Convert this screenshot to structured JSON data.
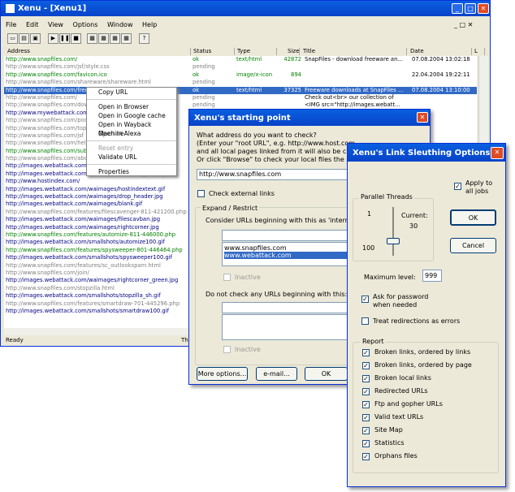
{
  "main_window": {
    "title": "Xenu - [Xenu1]",
    "menu": [
      "File",
      "Edit",
      "View",
      "Options",
      "Window",
      "Help"
    ],
    "status": "Ready",
    "status_right": "Thre"
  },
  "columns": {
    "address": "Address",
    "status": "Status",
    "type": "Type",
    "size": "Size",
    "title": "Title",
    "date": "Date",
    "extra": "L"
  },
  "rows": [
    {
      "a": "http://www.snapfiles.com/",
      "s": "ok",
      "t": "text/html",
      "z": "42872",
      "ti": "SnapFiles - download freeware an...",
      "d": "07.08.2004 13:02:18",
      "c": "ok"
    },
    {
      "a": "http://www.snapfiles.com/jsf/style.css",
      "s": "pending",
      "t": "",
      "z": "",
      "ti": "",
      "d": "",
      "c": "pend"
    },
    {
      "a": "http://www.snapfiles.com/favicon.ico",
      "s": "ok",
      "t": "image/x-icon",
      "z": "894",
      "ti": "",
      "d": "22.04.2004 19:22:11",
      "c": "ok"
    },
    {
      "a": "http://www.snapfiles.com/shareware/shareware.html",
      "s": "pending",
      "t": "",
      "z": "",
      "ti": "",
      "d": "",
      "c": "pend"
    },
    {
      "a": "http://www.snapfiles.com/freeware/freeware.html",
      "s": "ok",
      "t": "text/html",
      "z": "37325",
      "ti": "Freeware downloads at SnapFiles ...",
      "d": "07.08.2004 13:10:00",
      "c": "sel"
    },
    {
      "a": "http://www.snapfiles.com/",
      "s": "pending",
      "t": "",
      "z": "",
      "ti": "Check out<br> our collection of",
      "d": "",
      "c": "pend"
    },
    {
      "a": "http://www.snapfiles.com/downloads",
      "s": "pending",
      "t": "",
      "z": "",
      "ti": "<IMG src=\"http://images.webatt...",
      "d": "",
      "c": "pend"
    },
    {
      "a": "http://www.mywebattack.com/",
      "s": "",
      "t": "",
      "z": "",
      "ti": "",
      "d": "",
      "c": "nav"
    },
    {
      "a": "http://www.snapfiles.com/podcast",
      "s": "",
      "t": "",
      "z": "",
      "ti": "",
      "d": "",
      "c": "pend"
    },
    {
      "a": "http://www.snapfiles.com/topd",
      "s": "",
      "t": "",
      "z": "",
      "ti": "",
      "d": "",
      "c": "pend"
    },
    {
      "a": "http://www.snapfiles.com/jsf",
      "s": "",
      "t": "",
      "z": "",
      "ti": "",
      "d": "",
      "c": "pend"
    },
    {
      "a": "http://www.snapfiles.com/help/",
      "s": "",
      "t": "",
      "z": "",
      "ti": "",
      "d": "",
      "c": "pend"
    },
    {
      "a": "http://www.snapfiles.com/submit",
      "s": "",
      "t": "",
      "z": "",
      "ti": "",
      "d": "",
      "c": "ok"
    },
    {
      "a": "http://www.snapfiles.com/about",
      "s": "",
      "t": "",
      "z": "",
      "ti": "",
      "d": "",
      "c": "pend"
    },
    {
      "a": "http://images.webattack.com/waimages/sfheader_lowbg.jpg",
      "s": "",
      "t": "",
      "z": "",
      "ti": "",
      "d": "",
      "c": "nav"
    },
    {
      "a": "http://images.webattack.com/waimages/sfheader_low.jpg",
      "s": "",
      "t": "",
      "z": "",
      "ti": "",
      "d": "",
      "c": "nav"
    },
    {
      "a": "http://www.hostindex.com/",
      "s": "",
      "t": "",
      "z": "",
      "ti": "",
      "d": "",
      "c": "nav"
    },
    {
      "a": "http://images.webattack.com/waimages/hostindextext.gif",
      "s": "",
      "t": "",
      "z": "",
      "ti": "",
      "d": "",
      "c": "nav"
    },
    {
      "a": "http://images.webattack.com/waimages/drop_header.jpg",
      "s": "",
      "t": "",
      "z": "",
      "ti": "",
      "d": "",
      "c": "nav"
    },
    {
      "a": "http://images.webattack.com/waimages/blank.gif",
      "s": "",
      "t": "",
      "z": "",
      "ti": "",
      "d": "",
      "c": "nav"
    },
    {
      "a": "http://www.snapfiles.com/features/filescavenger-811-421200.php",
      "s": "",
      "t": "",
      "z": "",
      "ti": "",
      "d": "",
      "c": "pend"
    },
    {
      "a": "http://images.webattack.com/waimages/filescavban.jpg",
      "s": "",
      "t": "",
      "z": "",
      "ti": "",
      "d": "",
      "c": "nav"
    },
    {
      "a": "http://images.webattack.com/waimages/rightcorner.jpg",
      "s": "",
      "t": "",
      "z": "",
      "ti": "",
      "d": "",
      "c": "nav"
    },
    {
      "a": "http://www.snapfiles.com/features/automize-811-446000.php",
      "s": "",
      "t": "",
      "z": "",
      "ti": "",
      "d": "",
      "c": "ok"
    },
    {
      "a": "http://images.webattack.com/smallshots/automize100.gif",
      "s": "",
      "t": "",
      "z": "",
      "ti": "",
      "d": "",
      "c": "nav"
    },
    {
      "a": "http://www.snapfiles.com/features/spysweeper-801-446464.php",
      "s": "",
      "t": "",
      "z": "",
      "ti": "",
      "d": "",
      "c": "ok"
    },
    {
      "a": "http://images.webattack.com/smallshots/spysweeper100.gif",
      "s": "",
      "t": "",
      "z": "",
      "ti": "",
      "d": "",
      "c": "nav"
    },
    {
      "a": "http://www.snapfiles.com/features/sc_outlookspam.html",
      "s": "",
      "t": "",
      "z": "",
      "ti": "",
      "d": "",
      "c": "pend"
    },
    {
      "a": "http://www.snapfiles.com/join/",
      "s": "",
      "t": "",
      "z": "",
      "ti": "",
      "d": "",
      "c": "pend"
    },
    {
      "a": "http://images.webattack.com/waimages/rightcorner_green.jpg",
      "s": "",
      "t": "",
      "z": "",
      "ti": "",
      "d": "",
      "c": "nav"
    },
    {
      "a": "http://www.snapfiles.com/stopzilla.html",
      "s": "",
      "t": "",
      "z": "",
      "ti": "",
      "d": "",
      "c": "pend"
    },
    {
      "a": "http://images.webattack.com/smallshots/stopzilla_sh.gif",
      "s": "",
      "t": "",
      "z": "",
      "ti": "",
      "d": "",
      "c": "nav"
    },
    {
      "a": "http://www.snapfiles.com/features/smartdraw-701-445296.php",
      "s": "",
      "t": "",
      "z": "",
      "ti": "",
      "d": "",
      "c": "pend"
    },
    {
      "a": "http://images.webattack.com/smallshots/smartdraw100.gif",
      "s": "",
      "t": "",
      "z": "",
      "ti": "",
      "d": "",
      "c": "nav"
    }
  ],
  "context_menu": {
    "items": [
      "Copy URL",
      "Open in Browser",
      "Open in Google cache",
      "Open in Wayback Machine",
      "Open in Alexa",
      "Reset entry",
      "Validate URL",
      "Properties"
    ]
  },
  "start_dialog": {
    "title": "Xenu's starting point",
    "question": "What address do you want to check?",
    "hint1": "(Enter your \"root URL\", e.g. http://www.host.com",
    "hint2": "and all local pages linked from it will also be check",
    "hint3": "Or click \"Browse\" to check your local files the sam",
    "url": "http://www.snapfiles.com",
    "check_external": "Check external links",
    "expand_group": "Expand / Restrict",
    "consider_label": "Consider URLs beginning with this as 'internal':",
    "internal": [
      "www.snapfiles.com",
      "www.webattack.com"
    ],
    "inactive": "Inactive",
    "do_not_label": "Do not check any URLs beginning with this:",
    "more_options": "More options...",
    "email": "e-mail...",
    "ok": "OK"
  },
  "options_dialog": {
    "title": "Xenu's Link Sleuthing Options",
    "threads_label": "Parallel Threads",
    "threads_min": "1",
    "threads_max": "100",
    "current_label": "Current:",
    "current_value": "30",
    "threads_value": 30,
    "apply_all": "Apply to all jobs",
    "ok": "OK",
    "cancel": "Cancel",
    "max_level_label": "Maximum level:",
    "max_level": "999",
    "ask_password": "Ask for password when needed",
    "treat_redirect": "Treat redirections as errors",
    "report_label": "Report",
    "report_items": [
      "Broken links, ordered by links",
      "Broken links, ordered by page",
      "Broken local links",
      "Redirected URLs",
      "Ftp and gopher URLs",
      "Valid text URLs",
      "Site Map",
      "Statistics",
      "Orphans files"
    ]
  }
}
